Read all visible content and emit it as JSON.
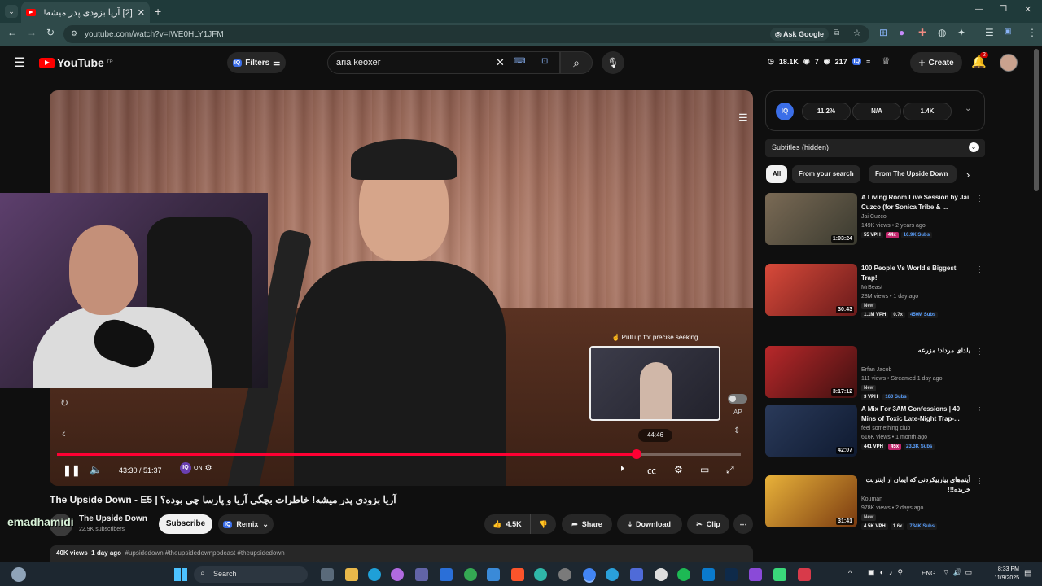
{
  "browser": {
    "tab_title": "[2] آریا بزودی پدر میشه! خاط",
    "url": "youtube.com/watch?v=IWE0HLY1JFM",
    "ask_google": "Ask Google"
  },
  "header": {
    "logo_text": "YouTube",
    "logo_sup": "TR",
    "filters_label": "Filters",
    "search_value": "aria keoxer",
    "stats": {
      "views": "18.1K",
      "a": "7",
      "b": "217"
    },
    "create_label": "Create",
    "notif_count": "2"
  },
  "player": {
    "pull_hint": "Pull up for precise seeking",
    "preview_time": "44:46",
    "timecode": "43:30 / 51:37",
    "ap_label": "AP",
    "on_label": "ON",
    "progress": 0.848,
    "preview_pos": 0.875
  },
  "video": {
    "title": "آریا بزودی پدر میشه! خاطرات بچگی آریا و پارسا چی بوده؟ | The Upside Down - E5",
    "channel_name": "The Upside Down",
    "subscribers": "22.9K subscribers",
    "watermark": "emadhamidi",
    "subscribe_label": "Subscribe",
    "remix_label": "Remix",
    "likes": "4.5K",
    "share_label": "Share",
    "download_label": "Download",
    "clip_label": "Clip",
    "desc_views": "40K views",
    "desc_age": "1 day ago",
    "desc_tags": "#upsidedown #theupsidedownpodcast #theupsidedown"
  },
  "sidebar": {
    "iq_stats": [
      "11.2%",
      "N/A",
      "1.4K"
    ],
    "subtitles_label": "Subtitles (hidden)",
    "chips": [
      "All",
      "From your search",
      "From The Upside Down"
    ],
    "recs": [
      {
        "title": "A Living Room Live Session by Jai Cuzco (for Sonica Tribe & ...",
        "channel": "Jai Cuzco",
        "meta": "149K views • 2 years ago",
        "duration": "1:03:24",
        "tags": [
          "55 VPH",
          "44x",
          "16.9K Subs"
        ],
        "new": ""
      },
      {
        "title": "100 People Vs World's Biggest Trap!",
        "channel": "MrBeast",
        "meta": "28M views • 1 day ago",
        "duration": "30:43",
        "tags": [
          "1.1M VPH",
          "0.7x",
          "450M Subs"
        ],
        "new": "New"
      },
      {
        "title": "یلدای مرداد! مزرعه",
        "channel": "Erfan Jacob",
        "meta": "111 views • Streamed 1 day ago",
        "duration": "3:17:12",
        "tags": [
          "3 VPH",
          "160 Subs"
        ],
        "new": "New"
      },
      {
        "title": "A Mix For 3AM Confessions | 40 Mins of Toxic Late-Night Trap-...",
        "channel": "feel something club",
        "meta": "616K views • 1 month ago",
        "duration": "42:07",
        "tags": [
          "441 VPH",
          "45x",
          "23.3K Subs"
        ],
        "new": ""
      },
      {
        "title": "آیتم‌های بیاربیکردنی که ایمان از اینترنت خریده!!!",
        "channel": "Kouman",
        "meta": "978K views • 2 days ago",
        "duration": "31:41",
        "tags": [
          "4.5K VPH",
          "1.6x",
          "734K Subs"
        ],
        "new": "New"
      }
    ]
  },
  "taskbar": {
    "search_label": "Search",
    "lang": "ENG",
    "time": "8:33 PM",
    "date": "11/9/2025"
  },
  "colors": {
    "accent": "#ff0033",
    "brand": "#ff0000",
    "subs_blue": "#5aa0ff",
    "multiplier_pink": "#c0246a"
  }
}
